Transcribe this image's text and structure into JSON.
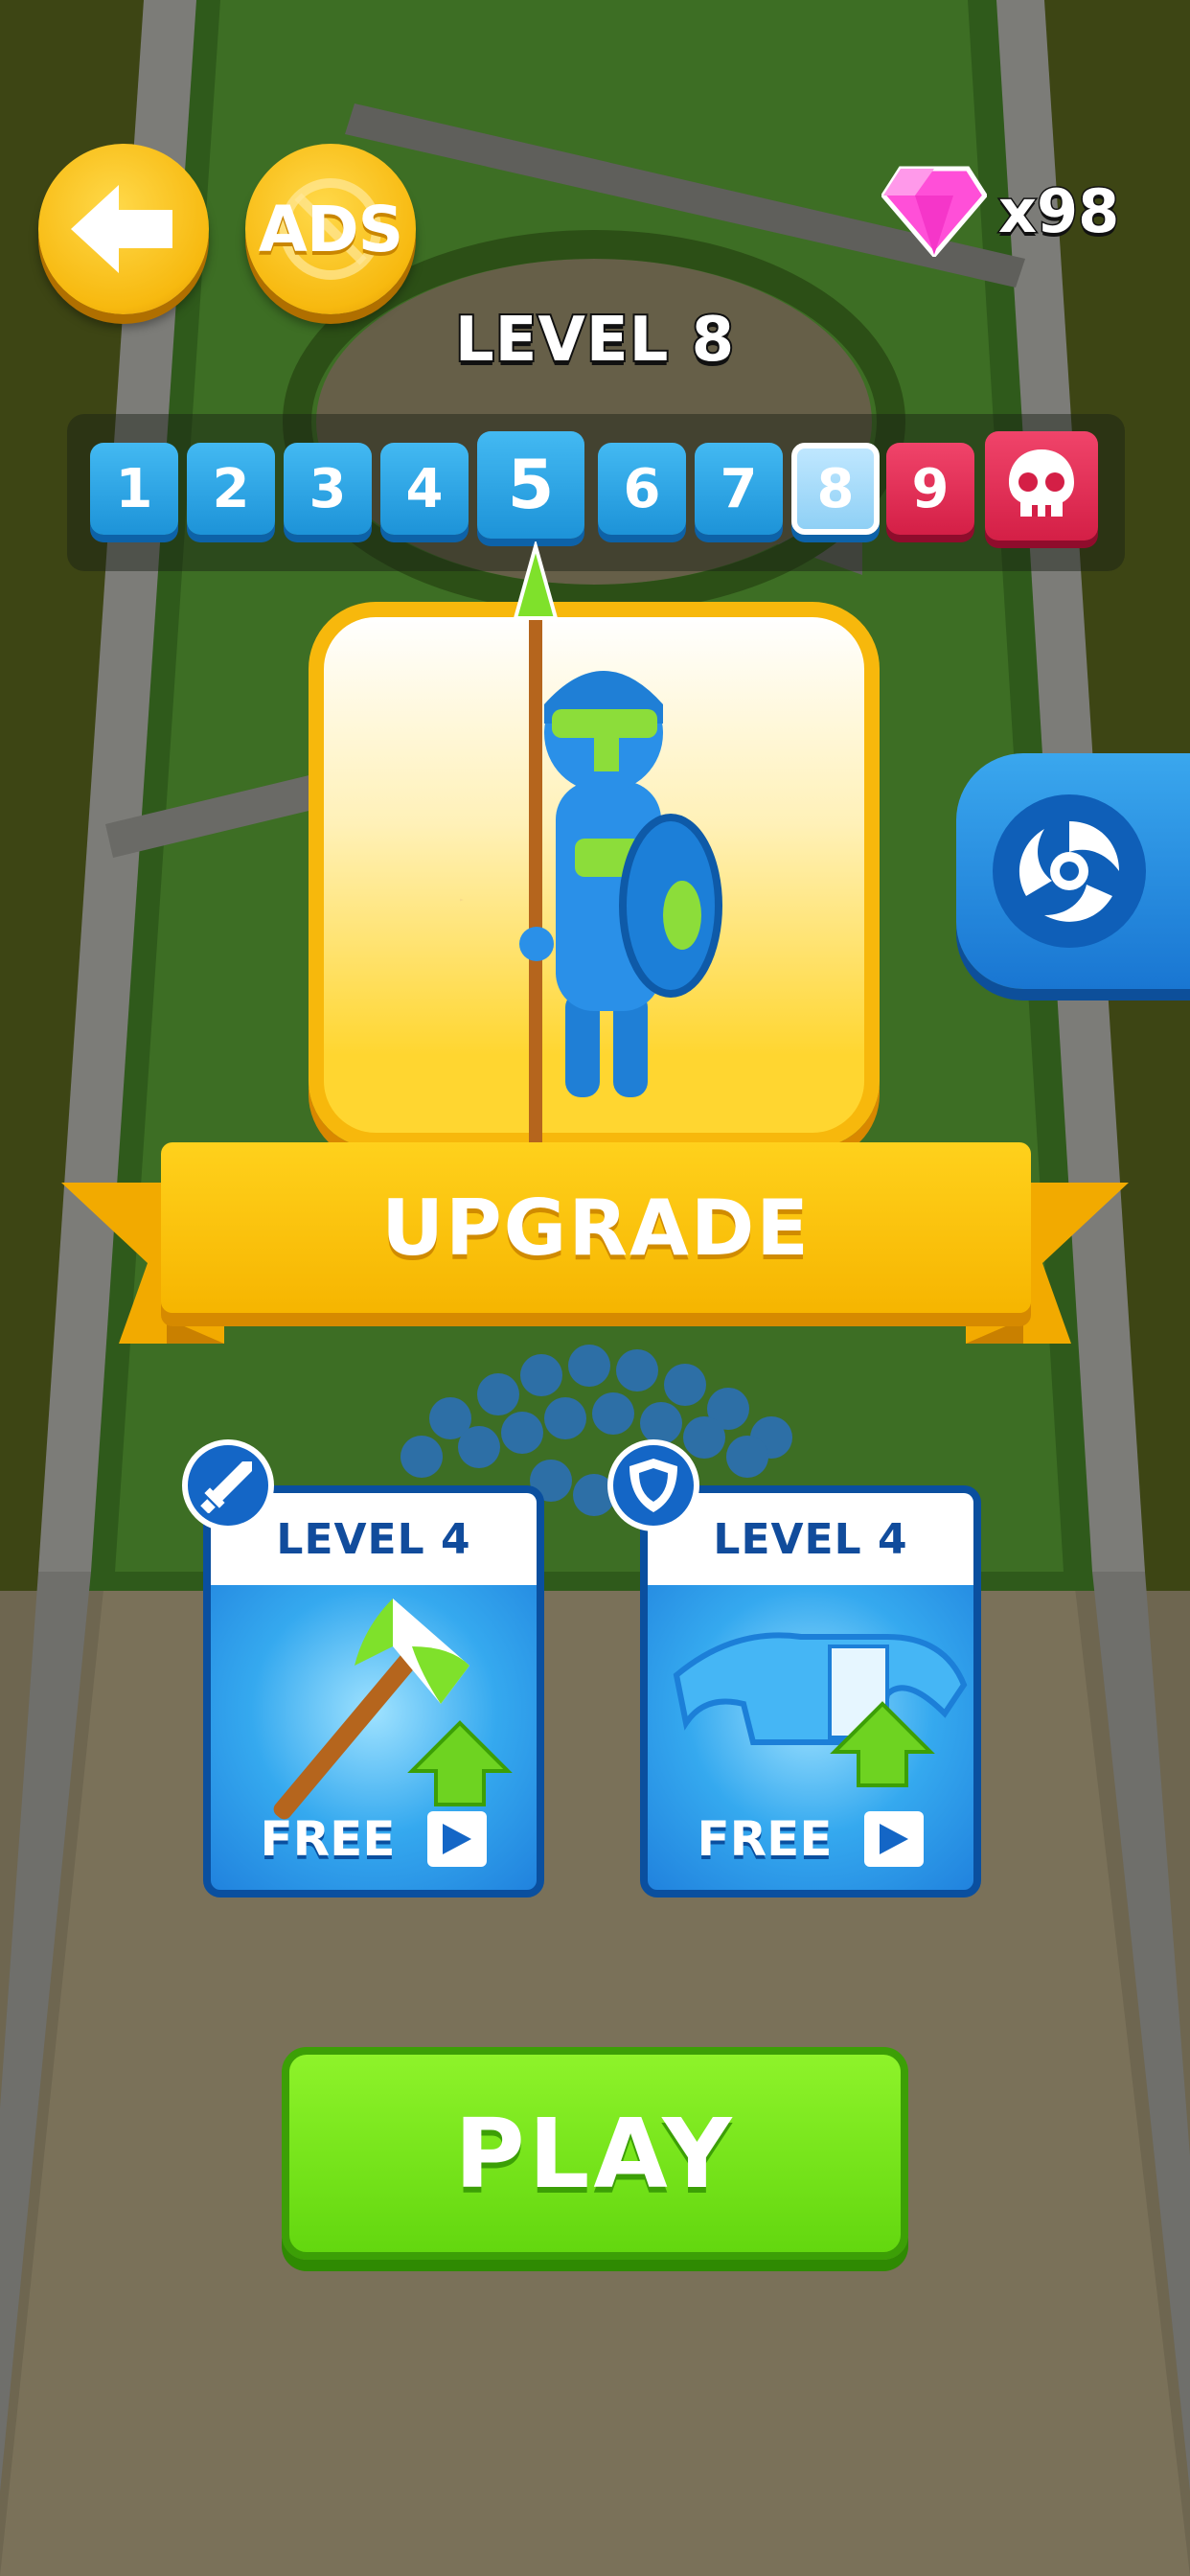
{
  "top_bar": {
    "ads_label": "ADS",
    "gem_count": "x98"
  },
  "level_title": "LEVEL 8",
  "level_progress": {
    "levels": [
      "1",
      "2",
      "3",
      "4",
      "5",
      "6",
      "7",
      "8",
      "9"
    ],
    "current_level": "8",
    "boss_icon": "skull-icon"
  },
  "upgrade_banner": "UPGRADE",
  "upgrade_cards": [
    {
      "level_label": "LEVEL 4",
      "price_label": "FREE",
      "badge_icon": "sword-icon",
      "item_icon": "axe-icon"
    },
    {
      "level_label": "LEVEL 4",
      "price_label": "FREE",
      "badge_icon": "shield-icon",
      "item_icon": "armor-icon"
    }
  ],
  "play_label": "PLAY",
  "side_button_icon": "swirl-icon",
  "colors": {
    "gold": "#f7b90f",
    "blue": "#1d93d8",
    "red": "#d41f46",
    "green": "#63d70f"
  }
}
